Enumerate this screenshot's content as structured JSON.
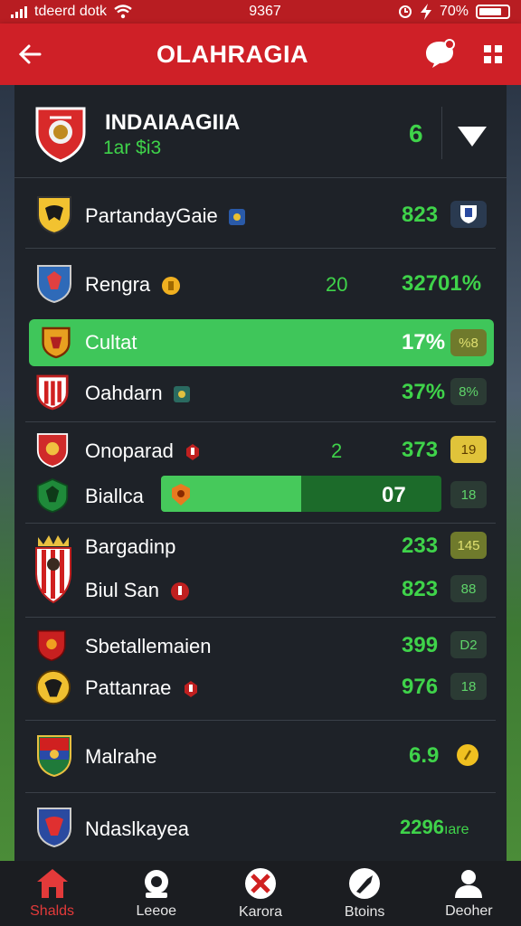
{
  "status_bar": {
    "left_text": "tdeerd dotk",
    "center_text": "9367",
    "battery": "70%"
  },
  "app_bar": {
    "title": "OLAHRAGIA"
  },
  "header_team": {
    "name": "INDAIAAGIIA",
    "subtitle": "1ar $i3",
    "score": "6"
  },
  "rows": [
    {
      "name": "PartandayGaie",
      "value": "823"
    },
    {
      "name": "Rengra",
      "mid": "20",
      "value": "32701%"
    },
    {
      "name": "Cultat",
      "value": "17%",
      "chip": "%8"
    },
    {
      "name": "Oahdarn",
      "value": "37%",
      "chip": "8%"
    },
    {
      "name": "Onoparad",
      "mid": "2",
      "value": "373",
      "chip": "19"
    },
    {
      "name": "Biallca",
      "value": "07",
      "chip": "18",
      "progress": 0.5
    },
    {
      "name": "Bargadinp",
      "value": "233",
      "chip": "145"
    },
    {
      "name": "Biul San",
      "value": "823",
      "chip": "88"
    },
    {
      "name": "Sbetallemaien",
      "value": "399",
      "chip": "D2"
    },
    {
      "name": "Pattanrae",
      "value": "976",
      "chip": "18"
    },
    {
      "name": "Malrahe",
      "value": "6.9"
    },
    {
      "name": "Ndaslkayea",
      "value": "2296",
      "value_suffix": "ıare"
    }
  ],
  "bottom_nav": [
    {
      "label": "Shalds",
      "icon": "home-icon"
    },
    {
      "label": "Leeoe",
      "icon": "ball-icon"
    },
    {
      "label": "Karora",
      "icon": "match-icon"
    },
    {
      "label": "Btoins",
      "icon": "whistle-icon"
    },
    {
      "label": "Deoher",
      "icon": "profile-icon"
    }
  ],
  "colors": {
    "primary_red": "#cf2027",
    "accent_green": "#3fd34a",
    "panel": "#1e2228"
  }
}
